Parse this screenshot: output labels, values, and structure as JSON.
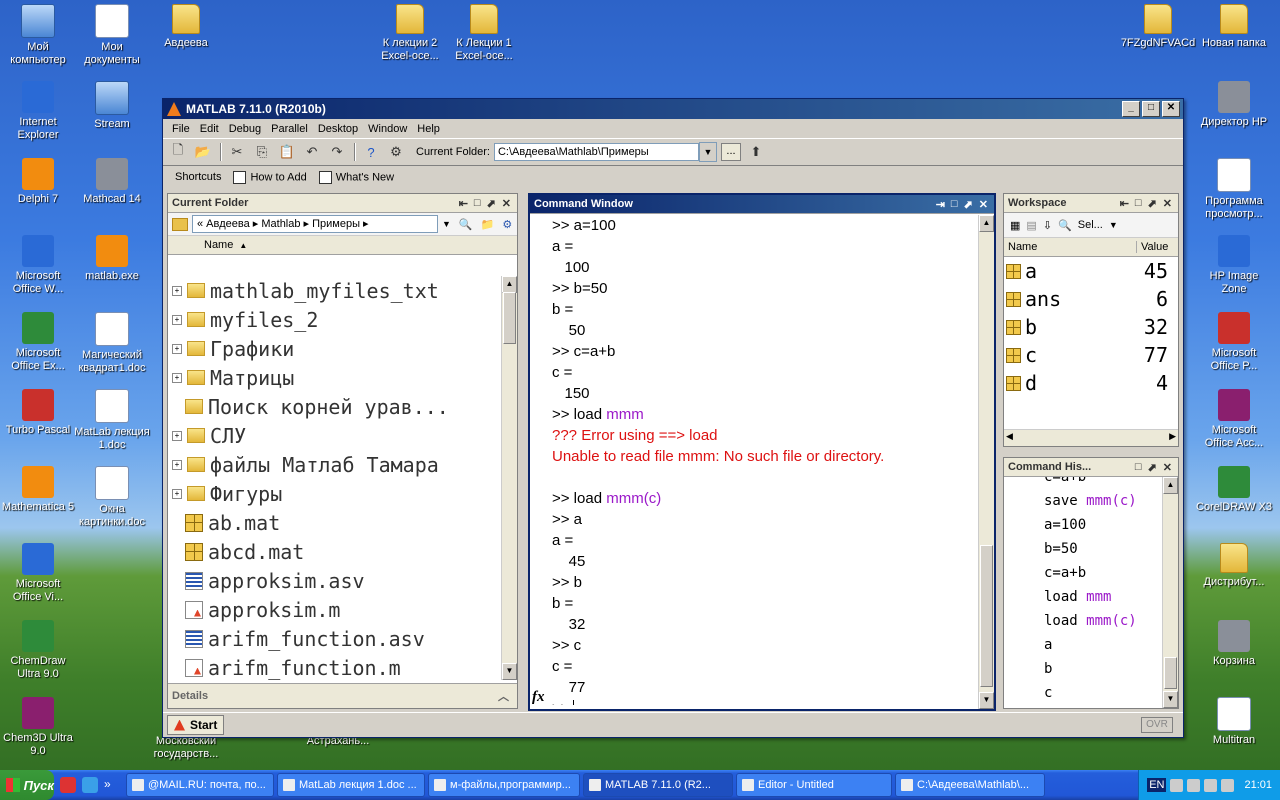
{
  "desktop": {
    "icons": [
      {
        "label": "Мой компьютер",
        "kind": "pc"
      },
      {
        "label": "Мои документы",
        "kind": "doc"
      },
      {
        "label": "Авдеева",
        "kind": "folder"
      },
      {
        "label": "К лекции 2 Excel-осе...",
        "kind": "folder"
      },
      {
        "label": "К Лекции 1 Excel-осе...",
        "kind": "folder"
      },
      {
        "label": "7FZgdNFVACd",
        "kind": "folder"
      },
      {
        "label": "Новая папка",
        "kind": "folder"
      },
      {
        "label": "Internet Explorer",
        "kind": "blue"
      },
      {
        "label": "Stream",
        "kind": "pc"
      },
      {
        "label": "Директор HP",
        "kind": "gray"
      },
      {
        "label": "Delphi 7",
        "kind": "orange"
      },
      {
        "label": "Mathcad 14",
        "kind": "gray"
      },
      {
        "label": "Программа просмотр...",
        "kind": "doc"
      },
      {
        "label": "Microsoft Office W...",
        "kind": "blue"
      },
      {
        "label": "matlab.exe",
        "kind": "orange"
      },
      {
        "label": "HP Image Zone",
        "kind": "blue"
      },
      {
        "label": "Microsoft Office Ex...",
        "kind": "green"
      },
      {
        "label": "Магический квадрат1.doc",
        "kind": "doc"
      },
      {
        "label": "Microsoft Office P...",
        "kind": "red"
      },
      {
        "label": "Turbo Pascal",
        "kind": "red"
      },
      {
        "label": "MatLab лекция 1.doc",
        "kind": "doc"
      },
      {
        "label": "Microsoft Office Acc...",
        "kind": "purple"
      },
      {
        "label": "Mathematica 5",
        "kind": "orange"
      },
      {
        "label": "Окна картинки.doc",
        "kind": "doc"
      },
      {
        "label": "CorelDRAW X3",
        "kind": "green"
      },
      {
        "label": "Microsoft Office Vi...",
        "kind": "blue"
      },
      {
        "label": "Дистрибут...",
        "kind": "folder"
      },
      {
        "label": "ChemDraw Ultra 9.0",
        "kind": "green"
      },
      {
        "label": "Корзина",
        "kind": "gray"
      },
      {
        "label": "Chem3D Ultra 9.0",
        "kind": "purple"
      },
      {
        "label": "Multitran",
        "kind": "doc"
      }
    ],
    "partial_labels": [
      "Московский государств...",
      "Астрахань..."
    ]
  },
  "matlab": {
    "title": "MATLAB  7.11.0 (R2010b)",
    "menu": [
      "File",
      "Edit",
      "Debug",
      "Parallel",
      "Desktop",
      "Window",
      "Help"
    ],
    "current_folder_label": "Current Folder:",
    "current_folder_value": "C:\\Авдеева\\Mathlab\\Примеры",
    "shortcuts": [
      "Shortcuts",
      "How to Add",
      "What's New"
    ],
    "folder_panel": {
      "title": "Current Folder",
      "path": "« Авдеева ▸ Mathlab ▸ Примеры ▸",
      "column": "Name",
      "files": [
        {
          "name": "mathlab_myfiles_txt",
          "type": "folder",
          "expand": true
        },
        {
          "name": "myfiles_2",
          "type": "folder",
          "expand": true
        },
        {
          "name": "Графики",
          "type": "folder",
          "expand": true
        },
        {
          "name": "Матрицы",
          "type": "folder",
          "expand": true
        },
        {
          "name": "Поиск корней урав...",
          "type": "folder",
          "expand": false
        },
        {
          "name": "СЛУ",
          "type": "folder",
          "expand": true
        },
        {
          "name": "файлы Матлаб Тамара",
          "type": "folder",
          "expand": true
        },
        {
          "name": "Фигуры",
          "type": "folder",
          "expand": true
        },
        {
          "name": "ab.mat",
          "type": "mat",
          "expand": false
        },
        {
          "name": "abcd.mat",
          "type": "mat",
          "expand": false
        },
        {
          "name": "approksim.asv",
          "type": "asv",
          "expand": false
        },
        {
          "name": "approksim.m",
          "type": "mfile",
          "expand": false
        },
        {
          "name": "arifm_function.asv",
          "type": "asv",
          "expand": false
        },
        {
          "name": "arifm_function.m",
          "type": "mfile",
          "expand": false
        }
      ],
      "details": "Details"
    },
    "command_window": {
      "title": "Command Window",
      "lines": [
        {
          "t": ">> a=100",
          "c": ""
        },
        {
          "t": "a =",
          "c": ""
        },
        {
          "t": "   100",
          "c": ""
        },
        {
          "t": ">> b=50",
          "c": ""
        },
        {
          "t": "b =",
          "c": ""
        },
        {
          "t": "    50",
          "c": ""
        },
        {
          "t": ">> c=a+b",
          "c": ""
        },
        {
          "t": "c =",
          "c": ""
        },
        {
          "t": "   150",
          "c": ""
        },
        {
          "t": ">> load ",
          "c": "",
          "kw": "mmm"
        },
        {
          "t": "??? Error using ==> load",
          "c": "err"
        },
        {
          "t": "Unable to read file mmm: No such file or directory.",
          "c": "err"
        },
        {
          "t": "",
          "c": ""
        },
        {
          "t": ">> load ",
          "c": "",
          "kw": "mmm(c)"
        },
        {
          "t": ">> a",
          "c": ""
        },
        {
          "t": "a =",
          "c": ""
        },
        {
          "t": "    45",
          "c": ""
        },
        {
          "t": ">> b",
          "c": ""
        },
        {
          "t": "b =",
          "c": ""
        },
        {
          "t": "    32",
          "c": ""
        },
        {
          "t": ">> c",
          "c": ""
        },
        {
          "t": "c =",
          "c": ""
        },
        {
          "t": "    77",
          "c": ""
        }
      ],
      "prompt": ">>",
      "fx": "fx"
    },
    "workspace": {
      "title": "Workspace",
      "select_label": "Sel...",
      "col_name": "Name",
      "col_value": "Value",
      "vars": [
        {
          "name": "a",
          "value": "45"
        },
        {
          "name": "ans",
          "value": "6"
        },
        {
          "name": "b",
          "value": "32"
        },
        {
          "name": "c",
          "value": "77"
        },
        {
          "name": "d",
          "value": "4"
        }
      ]
    },
    "history": {
      "title": "Command His...",
      "items": [
        {
          "text": "c=a+b",
          "kw": ""
        },
        {
          "text": "save ",
          "kw": "mmm(c)"
        },
        {
          "text": "a=100",
          "kw": ""
        },
        {
          "text": "b=50",
          "kw": ""
        },
        {
          "text": "c=a+b",
          "kw": ""
        },
        {
          "text": "load ",
          "kw": "mmm"
        },
        {
          "text": "load ",
          "kw": "mmm(c)"
        },
        {
          "text": "a",
          "kw": ""
        },
        {
          "text": "b",
          "kw": ""
        },
        {
          "text": "c",
          "kw": ""
        }
      ]
    },
    "start_label": "Start",
    "ovr_label": "OVR"
  },
  "taskbar": {
    "start": "Пуск",
    "tasks": [
      {
        "label": "@MAIL.RU: почта, по...",
        "active": false
      },
      {
        "label": "MatLab лекция 1.doc ...",
        "active": false
      },
      {
        "label": "м-файлы,программир...",
        "active": false
      },
      {
        "label": "MATLAB  7.11.0 (R2...",
        "active": true
      },
      {
        "label": "Editor - Untitled",
        "active": false
      },
      {
        "label": "C:\\Авдеева\\Mathlab\\...",
        "active": false
      }
    ],
    "lang": "EN",
    "clock": "21:01"
  }
}
